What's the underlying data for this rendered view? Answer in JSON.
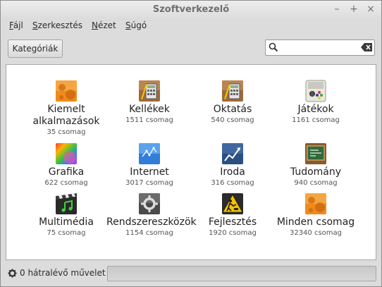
{
  "window": {
    "title": "Szoftverkezelő"
  },
  "window_controls": [
    "–",
    "+",
    "×"
  ],
  "menu": [
    {
      "label": "Fájl",
      "mnemonic": "F"
    },
    {
      "label": "Szerkesztés",
      "mnemonic": "S"
    },
    {
      "label": "Nézet",
      "mnemonic": "N"
    },
    {
      "label": "Súgó",
      "mnemonic": "S"
    }
  ],
  "toolbar": {
    "categories_label": "Kategóriák",
    "search": {
      "value": "",
      "placeholder": ""
    }
  },
  "categories": [
    {
      "name": "Kiemelt alkalmazások",
      "line1": "Kiemelt",
      "line2": "alkalmazások",
      "count": "35 csomag",
      "icon": "featured-icon"
    },
    {
      "name": "Kellékek",
      "line1": "Kellékek",
      "line2": "",
      "count": "1511 csomag",
      "icon": "accessories-icon"
    },
    {
      "name": "Oktatás",
      "line1": "Oktatás",
      "line2": "",
      "count": "540 csomag",
      "icon": "education-icon"
    },
    {
      "name": "Játékok",
      "line1": "Játékok",
      "line2": "",
      "count": "1161 csomag",
      "icon": "games-icon"
    },
    {
      "name": "Grafika",
      "line1": "Grafika",
      "line2": "",
      "count": "622 csomag",
      "icon": "graphics-icon"
    },
    {
      "name": "Internet",
      "line1": "Internet",
      "line2": "",
      "count": "3017 csomag",
      "icon": "internet-icon"
    },
    {
      "name": "Iroda",
      "line1": "Iroda",
      "line2": "",
      "count": "316 csomag",
      "icon": "office-icon"
    },
    {
      "name": "Tudomány",
      "line1": "Tudomány",
      "line2": "",
      "count": "940 csomag",
      "icon": "science-icon"
    },
    {
      "name": "Multimédia",
      "line1": "Multimédia",
      "line2": "",
      "count": "75 csomag",
      "icon": "multimedia-icon"
    },
    {
      "name": "Rendszereszközök",
      "line1": "Rendszereszközök",
      "line2": "",
      "count": "1154 csomag",
      "icon": "system-tools-icon"
    },
    {
      "name": "Fejlesztés",
      "line1": "Fejlesztés",
      "line2": "",
      "count": "1920 csomag",
      "icon": "development-icon"
    },
    {
      "name": "Minden csomag",
      "line1": "Minden csomag",
      "line2": "",
      "count": "32340 csomag",
      "icon": "all-packages-icon"
    }
  ],
  "status": {
    "text": "0 hátralévő művelet",
    "progress": 0
  },
  "colors": {
    "window_bg": "#dcdcdc",
    "content_bg": "#ffffff",
    "title_text": "#6f6f6f"
  }
}
